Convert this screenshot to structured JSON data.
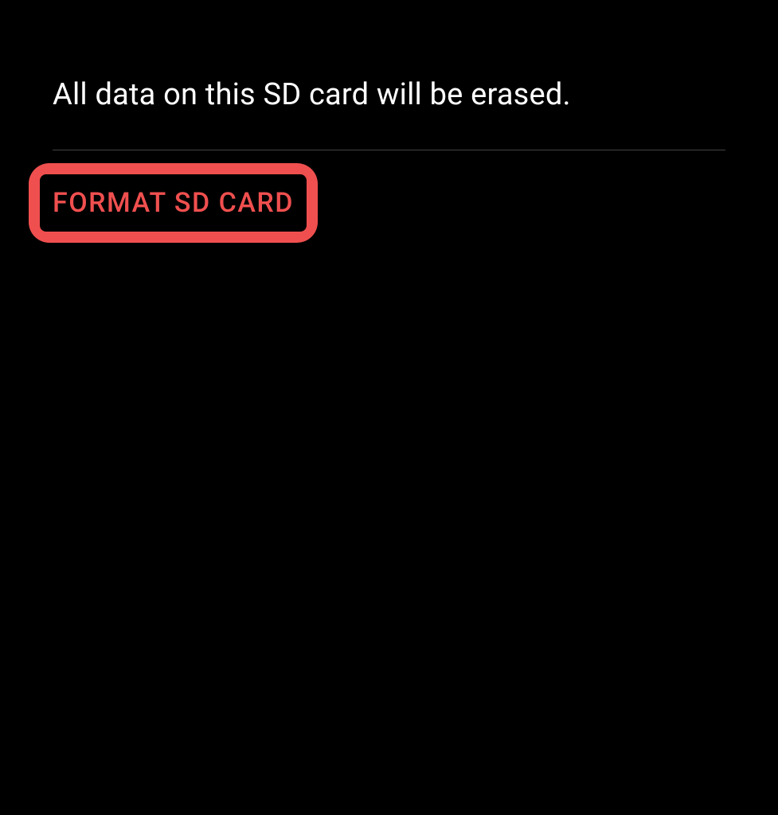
{
  "warning": {
    "message": "All data on this SD card will be erased."
  },
  "actions": {
    "format_button_label": "FORMAT SD CARD"
  },
  "colors": {
    "background": "#000000",
    "text": "#ffffff",
    "accent": "#f04f4f",
    "divider": "#444444"
  }
}
